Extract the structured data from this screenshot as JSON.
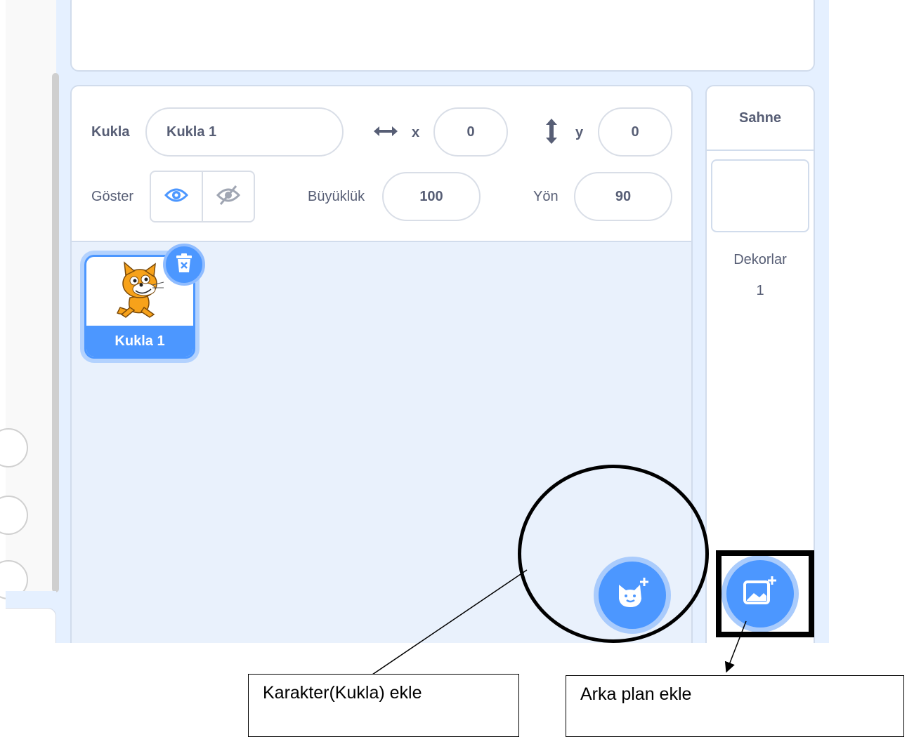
{
  "sprite_info": {
    "sprite_label": "Kukla",
    "sprite_name": "Kukla 1",
    "x_label": "x",
    "x_value": "0",
    "y_label": "y",
    "y_value": "0",
    "show_label": "Göster",
    "size_label": "Büyüklük",
    "size_value": "100",
    "direction_label": "Yön",
    "direction_value": "90"
  },
  "sprites": [
    {
      "name": "Kukla 1",
      "selected": true
    }
  ],
  "stage_panel": {
    "title": "Sahne",
    "backdrops_label": "Dekorlar",
    "backdrops_count": "1"
  },
  "annotations": {
    "add_sprite": "Karakter(Kukla) ekle",
    "add_backdrop": "Arka plan ekle"
  },
  "colors": {
    "accent": "#4c97ff",
    "text": "#575e75",
    "pane_bg": "#e9f1fc"
  },
  "icons": [
    "arrows-horizontal-icon",
    "arrows-vertical-icon",
    "eye-icon",
    "eye-slash-icon",
    "trash-icon",
    "cat-add-icon",
    "image-add-icon"
  ]
}
